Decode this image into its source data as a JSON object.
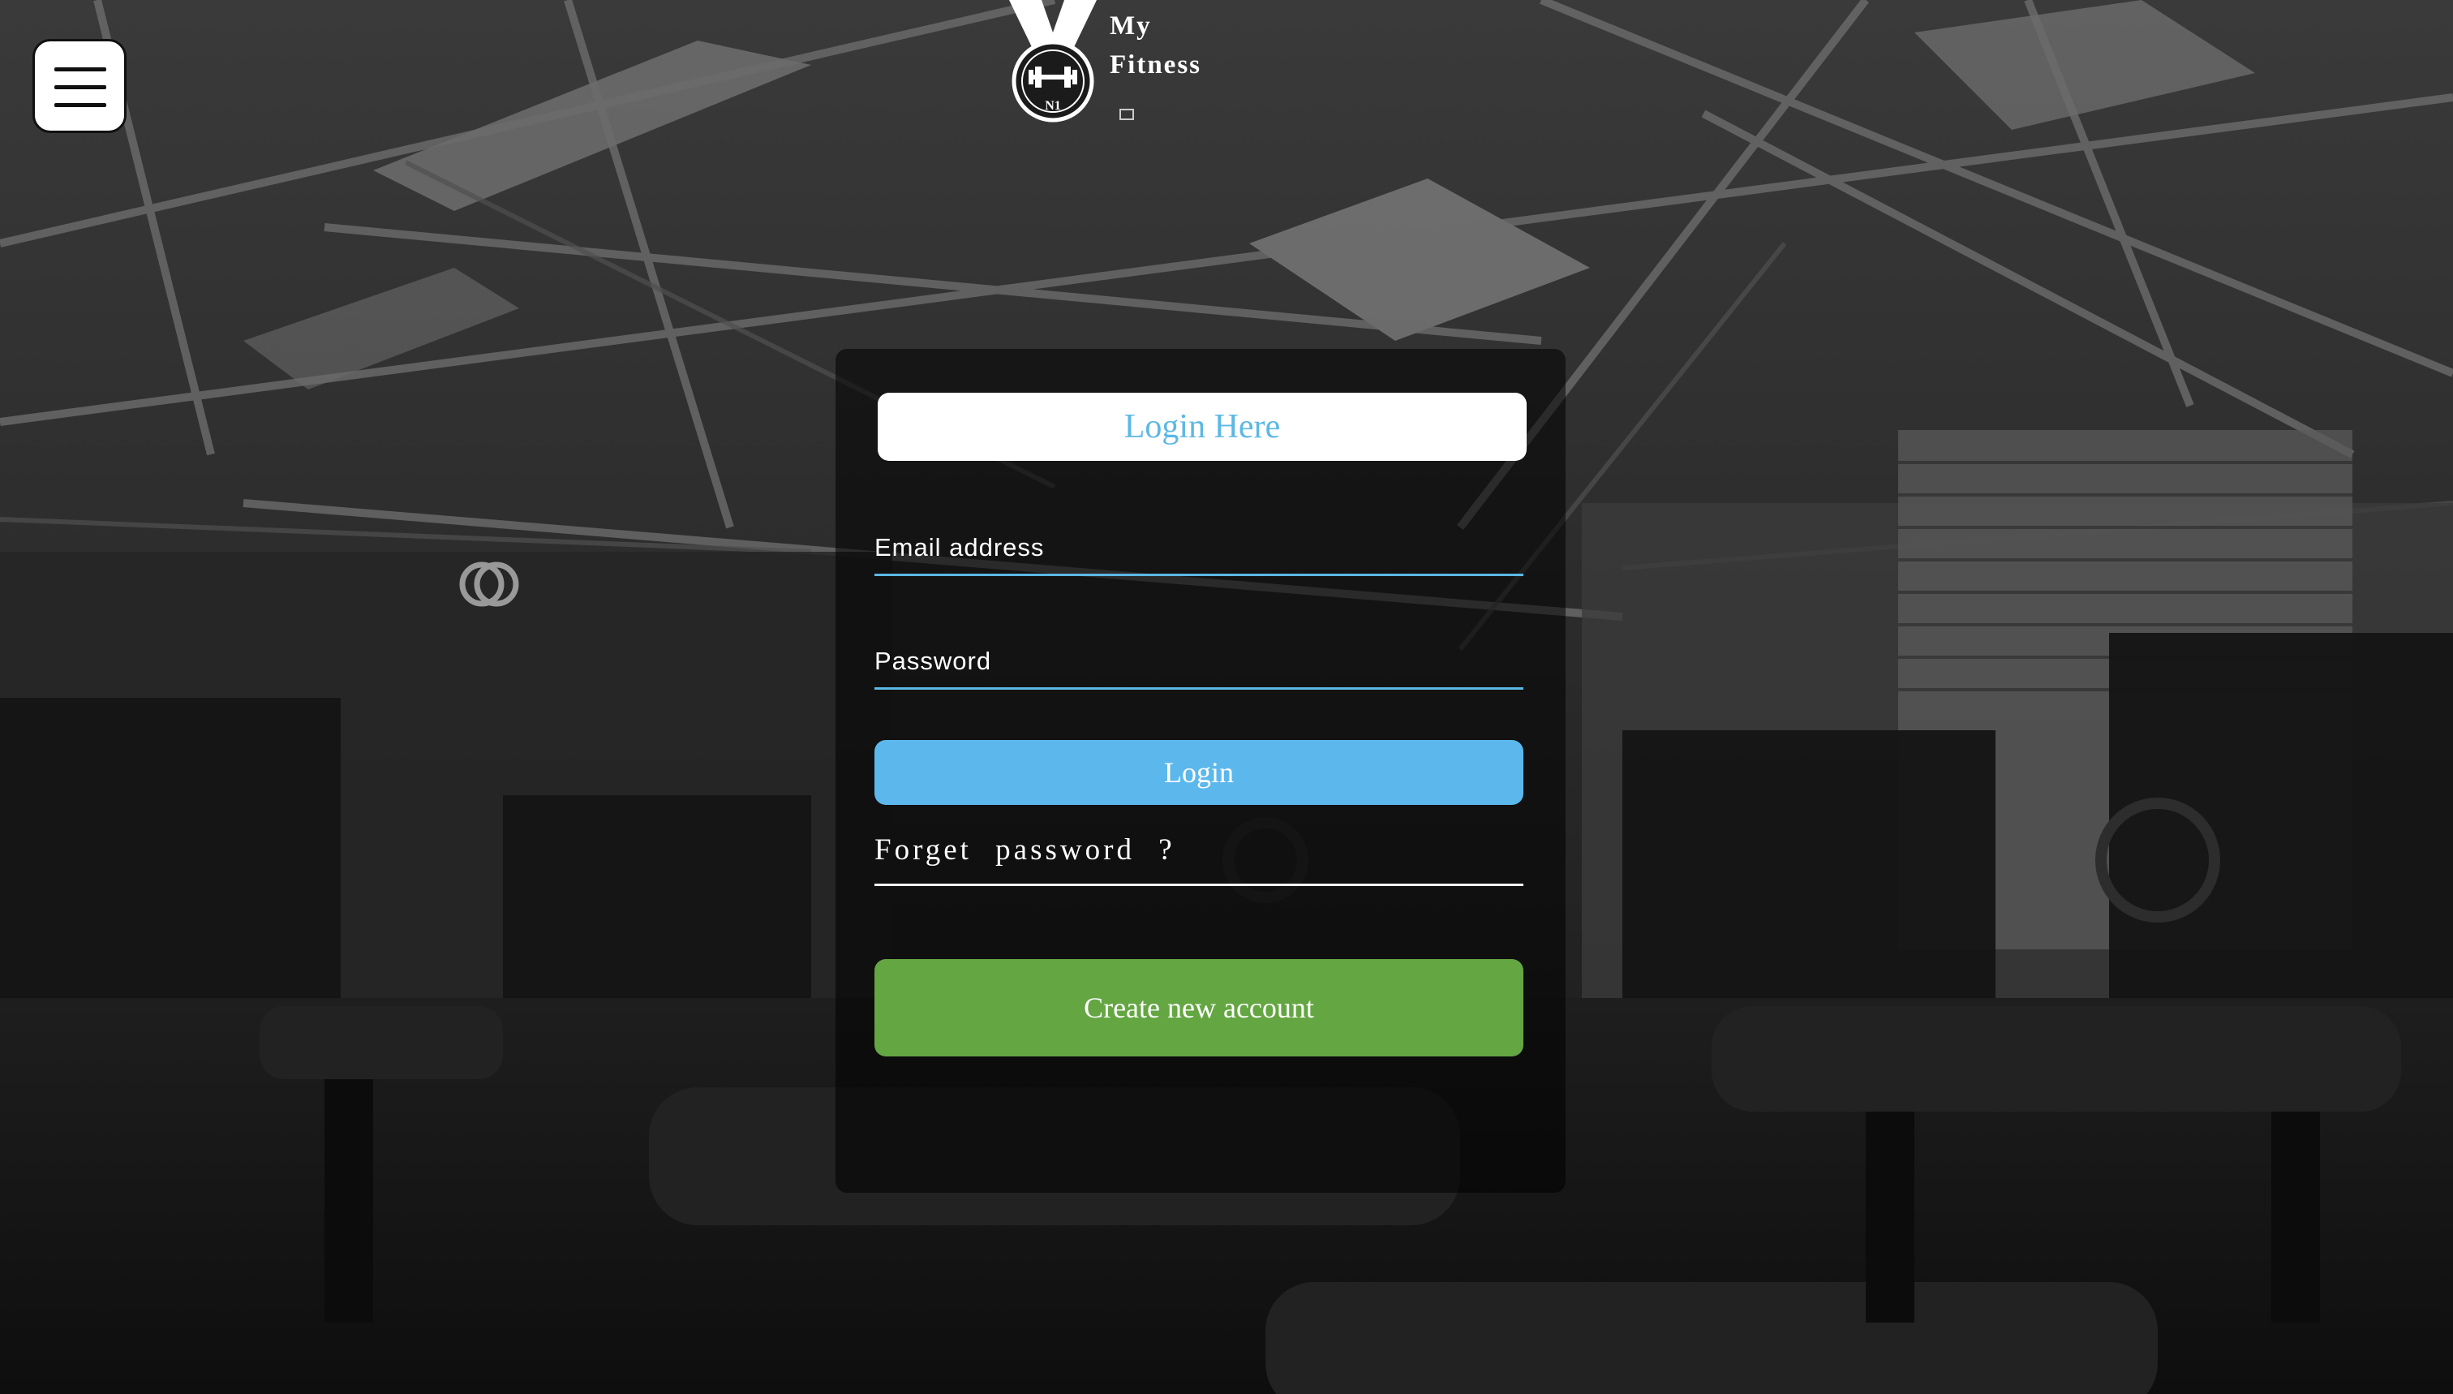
{
  "brand": {
    "line1": "My",
    "line2": "Fitness",
    "medal_text": "N1"
  },
  "menu": {
    "icon": "hamburger-menu-icon"
  },
  "login_form": {
    "title": "Login Here",
    "email_label": "Email address",
    "password_label": "Password",
    "login_label": "Login",
    "forgot_label": "Forget password ?",
    "create_account_label": "Create new account"
  },
  "colors": {
    "accent_blue": "#5cb8ec",
    "create_green": "#64a642",
    "panel_overlay": "rgba(0,0,0,0.55)"
  }
}
